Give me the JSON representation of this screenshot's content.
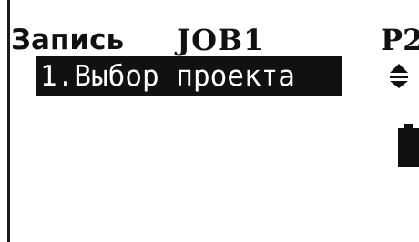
{
  "header": {
    "title": "Запись",
    "job": "JOB1",
    "page": "P2"
  },
  "menu": {
    "items": [
      {
        "label": "1.Выбор проекта",
        "selected": true
      }
    ]
  },
  "status": {
    "scroll_icon": "scroll-up-down-icon",
    "battery_icon": "battery-icon"
  },
  "colors": {
    "background": "#ffffff",
    "foreground": "#111111",
    "highlight_bg": "#111111",
    "highlight_fg": "#ffffff"
  }
}
